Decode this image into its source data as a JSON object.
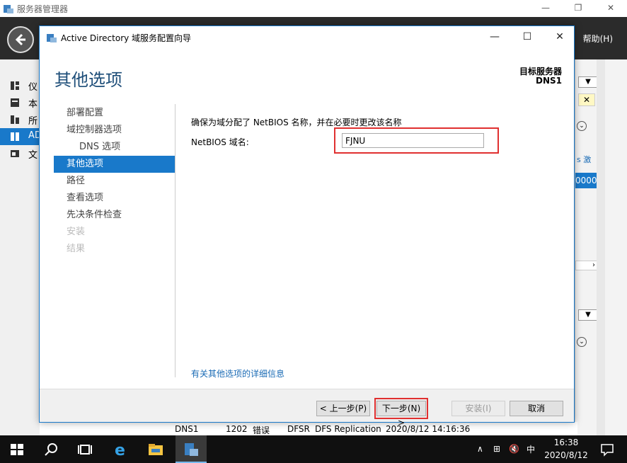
{
  "server_manager": {
    "title": "服务器管理器",
    "help_menu": "帮助(H)",
    "nav_items": [
      {
        "label": "仪",
        "icon": "dashboard-icon"
      },
      {
        "label": "本",
        "icon": "local-server-icon"
      },
      {
        "label": "所",
        "icon": "all-servers-icon"
      },
      {
        "label": "AD",
        "icon": "ad-ds-icon"
      },
      {
        "label": "文",
        "icon": "file-services-icon"
      }
    ],
    "right_fragments": {
      "task_text": "s 激",
      "value_text": "0000"
    },
    "bottom_row": [
      "DNS1",
      "1202",
      "错误",
      "DFSR",
      "DFS Replication",
      "2020/8/12 14:16:36"
    ]
  },
  "wizard": {
    "title": "Active Directory 域服务配置向导",
    "heading": "其他选项",
    "target_label": "目标服务器",
    "target_value": "DNS1",
    "steps": [
      {
        "label": "部署配置",
        "state": "normal"
      },
      {
        "label": "域控制器选项",
        "state": "normal"
      },
      {
        "label": "DNS 选项",
        "state": "sub"
      },
      {
        "label": "其他选项",
        "state": "selected"
      },
      {
        "label": "路径",
        "state": "normal"
      },
      {
        "label": "查看选项",
        "state": "normal"
      },
      {
        "label": "先决条件检查",
        "state": "normal"
      },
      {
        "label": "安装",
        "state": "disabled"
      },
      {
        "label": "结果",
        "state": "disabled"
      }
    ],
    "description": "确保为域分配了 NetBIOS 名称，并在必要时更改该名称",
    "netbios_label": "NetBIOS 域名:",
    "netbios_value": "FJNU",
    "more_info_link": "有关其他选项的详细信息",
    "buttons": {
      "prev": "< 上一步(P)",
      "next": "下一步(N) >",
      "install": "安装(I)",
      "cancel": "取消"
    }
  },
  "taskbar": {
    "time": "16:38",
    "date": "2020/8/12",
    "ime": "中"
  }
}
